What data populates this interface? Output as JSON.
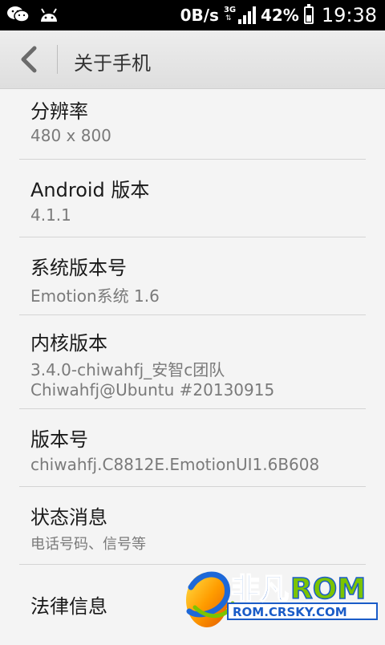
{
  "status_bar": {
    "left_icons": [
      "wechat-icon",
      "android-icon"
    ],
    "net_speed": "0B/s",
    "network": "3G",
    "battery": "42%",
    "battery_level": 0.42,
    "time": "19:38"
  },
  "header": {
    "title": "关于手机",
    "back_icon": "chevron-left-icon"
  },
  "items": [
    {
      "title": "分辨率",
      "value": "480 x 800"
    },
    {
      "title": "Android 版本",
      "value": "4.1.1"
    },
    {
      "title": "系统版本号",
      "value": "Emotion系统 1.6"
    },
    {
      "title": "内核版本",
      "value": "3.4.0-chiwahfj_安智c团队",
      "value2": "Chiwahfj@Ubuntu #20130915"
    },
    {
      "title": "版本号",
      "value": "chiwahfj.C8812E.EmotionUI1.6B608"
    },
    {
      "title": "状态消息",
      "value": "电话号码、信号等"
    },
    {
      "title": "法律信息"
    }
  ],
  "watermark": {
    "brand_cn": "非凡",
    "brand_en": "ROM",
    "url": "ROM.CRSKY.COM"
  },
  "colors": {
    "status_bar": "#000000",
    "header_bg": "#e6e6e6",
    "list_bg": "#f4f4f4",
    "title_text": "#1a1a1a",
    "value_text": "#7a7a7a",
    "watermark_blue": "#1a5cc8",
    "watermark_green": "#7cc400"
  }
}
